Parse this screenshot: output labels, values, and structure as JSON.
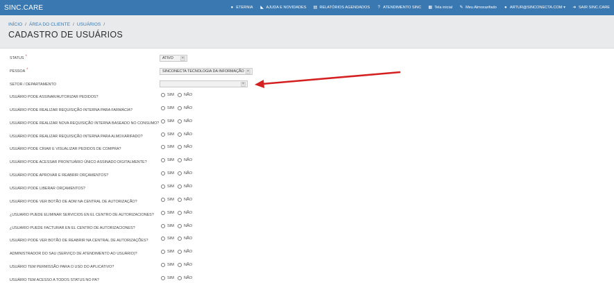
{
  "app": {
    "brand": "SINC.CARE"
  },
  "nav": [
    {
      "name": "nav-eternia",
      "icon": "chat-icon",
      "glyph": "●",
      "label": "ETERNIA"
    },
    {
      "name": "nav-ajuda",
      "icon": "rss-icon",
      "glyph": "◣",
      "label": "AJUDA E NOVIDADES"
    },
    {
      "name": "nav-relatorios",
      "icon": "report-icon",
      "glyph": "▤",
      "label": "RELATÓRIOS AGENDADOS"
    },
    {
      "name": "nav-atendimento",
      "icon": "question-icon",
      "glyph": "?",
      "label": "ATENDIMENTO SINC"
    },
    {
      "name": "nav-tela-inicial",
      "icon": "calendar-icon",
      "glyph": "▦",
      "label": "Tela inicial"
    },
    {
      "name": "nav-almoxarifado",
      "icon": "edit-icon",
      "glyph": "✎",
      "label": "Meu Almoxarifado"
    },
    {
      "name": "nav-user",
      "icon": "user-icon",
      "glyph": "●",
      "label": "ARTUR@SINCONECTA.COM ▾"
    },
    {
      "name": "nav-sair",
      "icon": "logout-icon",
      "glyph": "➜",
      "label": "SAIR SINC.CARE"
    }
  ],
  "breadcrumb": {
    "item1": "INÍCIO",
    "item2": "ÁREA DO CLIENTE",
    "item3": "USUÁRIOS",
    "sep": "/"
  },
  "page": {
    "title": "CADASTRO DE USUÁRIOS"
  },
  "form": {
    "status": {
      "label": "STATUS",
      "required": "*",
      "value": "ATIVO",
      "clear": "×"
    },
    "pessoa": {
      "label": "PESSOA",
      "required": "*",
      "value": "SINCONECTA TECNOLOGIA DA INFORMAÇÃO",
      "clear": "×"
    },
    "setor": {
      "label": "SETOR / DEPARTAMENTO",
      "value": "",
      "clear": "×"
    },
    "radio_options": {
      "yes": "SIM",
      "no": "NÃO"
    },
    "questions": [
      "USUÁRIO PODE ASSINAR/AUTORIZAR PEDIDOS?",
      "USUÁRIO PODE REALIZAR REQUISIÇÃO INTERNA PARA FARMÁCIA?",
      "USUÁRIO PODE REALIZAR NOVA REQUISIÇÃO INTERNA BASEADO NO CONSUMO?",
      "USUÁRIO PODE REALIZAR REQUISIÇÃO INTERNA PARA ALMOXARIFADO?",
      "USUÁRIO PODE CRIAR E VISUALIZAR PEDIDOS DE COMPRA?",
      "USUÁRIO PODE ACESSAR PRONTUÁRIO ÚNICO ASSINADO DIGITALMENTE?",
      "USUÁRIO PODE APROVAR E REABRIR ORÇAMENTOS?",
      "USUÁRIO PODE LIBERAR ORÇAMENTOS?",
      "USUÁRIO PODE VER BOTÃO DE ADM NA CENTRAL DE AUTORIZAÇÃO?",
      "¿USUARIO PUEDE ELIMINAR SERVICIOS EN EL CENTRO DE AUTORIZACIONES?",
      "¿USUARIO PUEDE FACTURAR EN EL CENTRO DE AUTORIZACIONES?",
      "USUÁRIO PODE VER BOTÃO DE REABRIR NA CENTRAL DE AUTORIZAÇÕES?",
      "ADMINISTRADOR DO SAU (SERVIÇO DE ATENDIMENTO AO USUÁRIO)?",
      "USUÁRIO TEM PERMISSÃO PARA O USO DO APLICATIVO?",
      "USUÁRIO TEM ACESSO A TODOS STATUS NO PA?"
    ]
  },
  "colors": {
    "topbar": "#3a78b1",
    "header_bg": "#e8eaec",
    "link": "#3a78b1",
    "required": "#d9534f",
    "arrow": "#d42020"
  }
}
